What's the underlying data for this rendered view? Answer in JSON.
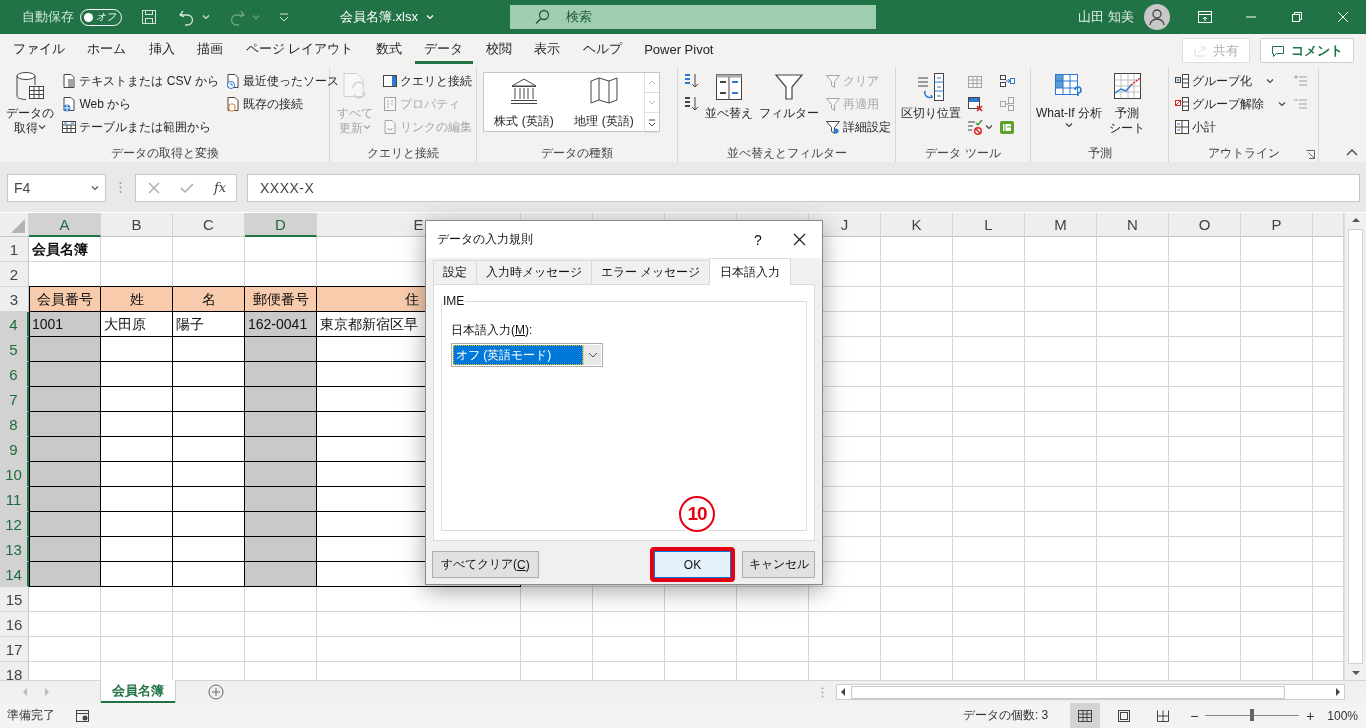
{
  "title_bar": {
    "autosave_label": "自動保存",
    "autosave_toggle": {
      "label": "オフ",
      "on": false
    },
    "file_name": "会員名簿.xlsx",
    "search": {
      "placeholder": "検索"
    },
    "user_name": "山田 知美"
  },
  "ribbon_tabs": [
    {
      "label": "ファイル",
      "selected": false
    },
    {
      "label": "ホーム",
      "selected": false
    },
    {
      "label": "挿入",
      "selected": false
    },
    {
      "label": "描画",
      "selected": false
    },
    {
      "label": "ページ レイアウト",
      "selected": false
    },
    {
      "label": "数式",
      "selected": false
    },
    {
      "label": "データ",
      "selected": true
    },
    {
      "label": "校閲",
      "selected": false
    },
    {
      "label": "表示",
      "selected": false
    },
    {
      "label": "ヘルプ",
      "selected": false
    },
    {
      "label": "Power Pivot",
      "selected": false
    }
  ],
  "share_button": {
    "label": "共有",
    "disabled": true
  },
  "comment_button": {
    "label": "コメント"
  },
  "ribbon_groups": [
    {
      "label": "データの取得と変換",
      "kind": "buttons",
      "columns": [
        [
          {
            "kind": "large",
            "label": "データの取得",
            "dropdown": true,
            "disabled": false
          }
        ],
        [
          {
            "kind": "small",
            "label": "テキストまたは CSV から",
            "dropdown": false,
            "disabled": false
          },
          {
            "kind": "small",
            "label": "Web から",
            "dropdown": false,
            "disabled": false
          },
          {
            "kind": "small",
            "label": "テーブルまたは範囲から",
            "dropdown": false,
            "disabled": false
          }
        ],
        [
          {
            "kind": "small",
            "label": "最近使ったソース",
            "dropdown": false,
            "disabled": false
          },
          {
            "kind": "small",
            "label": "既存の接続",
            "dropdown": false,
            "disabled": false
          }
        ]
      ]
    },
    {
      "label": "クエリと接続",
      "kind": "buttons",
      "columns": [
        [
          {
            "kind": "large",
            "label": "すべて更新",
            "dropdown": true,
            "disabled": true
          }
        ],
        [
          {
            "kind": "small",
            "label": "クエリと接続",
            "dropdown": false,
            "disabled": false
          },
          {
            "kind": "small",
            "label": "プロパティ",
            "dropdown": false,
            "disabled": true
          },
          {
            "kind": "small",
            "label": "リンクの編集",
            "dropdown": false,
            "disabled": true
          }
        ]
      ]
    },
    {
      "label": "データの種類",
      "kind": "gallery",
      "items": [
        {
          "label": "株式 (英語)"
        },
        {
          "label": "地理 (英語)"
        }
      ]
    },
    {
      "label": "並べ替えとフィルター",
      "kind": "buttons",
      "columns": [
        [
          {
            "kind": "icon",
            "dropdown": false,
            "disabled": false
          },
          {
            "kind": "icon",
            "dropdown": false,
            "disabled": false
          }
        ],
        [
          {
            "kind": "large",
            "label": "並べ替え",
            "dropdown": false,
            "disabled": false
          }
        ],
        [
          {
            "kind": "large",
            "label": "フィルター",
            "dropdown": false,
            "disabled": false
          }
        ],
        [
          {
            "kind": "small",
            "label": "クリア",
            "dropdown": false,
            "disabled": true
          },
          {
            "kind": "small",
            "label": "再適用",
            "dropdown": false,
            "disabled": true
          },
          {
            "kind": "small",
            "label": "詳細設定",
            "dropdown": false,
            "disabled": false
          }
        ]
      ]
    },
    {
      "label": "データ ツール",
      "kind": "buttons",
      "columns": [
        [
          {
            "kind": "large",
            "label": "区切り位置",
            "dropdown": false,
            "disabled": false
          }
        ],
        [
          {
            "kind": "icon",
            "dropdown": false,
            "disabled": true
          },
          {
            "kind": "icon",
            "dropdown": false,
            "disabled": false
          },
          {
            "kind": "icon",
            "dropdown": true,
            "disabled": false
          }
        ],
        [
          {
            "kind": "icon",
            "dropdown": false,
            "disabled": false
          },
          {
            "kind": "icon",
            "dropdown": false,
            "disabled": true
          },
          {
            "kind": "icon",
            "dropdown": false,
            "disabled": false
          }
        ]
      ]
    },
    {
      "label": "予測",
      "kind": "buttons",
      "columns": [
        [
          {
            "kind": "large",
            "label": "What-If 分析",
            "dropdown": true,
            "disabled": false
          }
        ],
        [
          {
            "kind": "large",
            "label": "予測シート",
            "dropdown": false,
            "disabled": false
          }
        ]
      ]
    },
    {
      "label": "アウトライン",
      "kind": "buttons",
      "launcher": true,
      "columns": [
        [
          {
            "kind": "small",
            "label": "グループ化",
            "dropdown": true,
            "disabled": false
          },
          {
            "kind": "small",
            "label": "グループ解除",
            "dropdown": true,
            "disabled": false
          },
          {
            "kind": "small",
            "label": "小計",
            "dropdown": false,
            "disabled": false
          }
        ],
        [
          {
            "kind": "icon",
            "dropdown": false,
            "disabled": true
          },
          {
            "kind": "icon",
            "dropdown": false,
            "disabled": true
          }
        ]
      ]
    }
  ],
  "formula_bar": {
    "name_box": "F4",
    "function_label": "fx",
    "value": "XXXX-X"
  },
  "grid": {
    "columns": [
      {
        "label": "A",
        "selected": true,
        "shaded": true,
        "in_table": true
      },
      {
        "label": "B",
        "selected": false,
        "shaded": false,
        "in_table": true
      },
      {
        "label": "C",
        "selected": false,
        "shaded": false,
        "in_table": true
      },
      {
        "label": "D",
        "selected": true,
        "shaded": true,
        "in_table": true
      },
      {
        "label": "E",
        "selected": false,
        "shaded": false,
        "in_table": true
      },
      {
        "selected": false,
        "shaded": false,
        "in_table": false
      },
      {
        "selected": false,
        "shaded": false,
        "in_table": false
      },
      {
        "selected": false,
        "shaded": false,
        "in_table": false
      },
      {
        "selected": false,
        "shaded": false,
        "in_table": false
      },
      {
        "label": "J",
        "selected": false,
        "shaded": false,
        "in_table": false
      },
      {
        "label": "K",
        "selected": false,
        "shaded": false,
        "in_table": false
      },
      {
        "label": "L",
        "selected": false,
        "shaded": false,
        "in_table": false
      },
      {
        "label": "M",
        "selected": false,
        "shaded": false,
        "in_table": false
      },
      {
        "label": "N",
        "selected": false,
        "shaded": false,
        "in_table": false
      },
      {
        "label": "O",
        "selected": false,
        "shaded": false,
        "in_table": false
      },
      {
        "label": "P",
        "selected": false,
        "shaded": false,
        "in_table": false
      }
    ],
    "rows": [
      {
        "label": "1",
        "selected": false,
        "kind": "title",
        "cells": [
          "会員名簿"
        ]
      },
      {
        "label": "2",
        "selected": false,
        "kind": "plain"
      },
      {
        "label": "3",
        "selected": false,
        "kind": "header",
        "cells": [
          "会員番号",
          "姓",
          "名",
          "郵便番号",
          "住"
        ]
      },
      {
        "label": "4",
        "selected": true,
        "kind": "data",
        "cells": [
          "1001",
          "大田原",
          "陽子",
          "162-0041",
          "東京都新宿区早"
        ]
      },
      {
        "label": "5",
        "selected": true,
        "kind": "data"
      },
      {
        "label": "6",
        "selected": true,
        "kind": "data"
      },
      {
        "label": "7",
        "selected": true,
        "kind": "data"
      },
      {
        "label": "8",
        "selected": true,
        "kind": "data"
      },
      {
        "label": "9",
        "selected": true,
        "kind": "data"
      },
      {
        "label": "10",
        "selected": true,
        "kind": "data"
      },
      {
        "label": "11",
        "selected": true,
        "kind": "data"
      },
      {
        "label": "12",
        "selected": true,
        "kind": "data"
      },
      {
        "label": "13",
        "selected": true,
        "kind": "data"
      },
      {
        "label": "14",
        "selected": true,
        "kind": "data"
      },
      {
        "label": "15",
        "selected": false,
        "kind": "plain"
      },
      {
        "label": "16",
        "selected": false,
        "kind": "plain"
      },
      {
        "label": "17",
        "selected": false,
        "kind": "plain"
      },
      {
        "label": "18",
        "selected": false,
        "kind": "plain"
      }
    ]
  },
  "dialog": {
    "title": "データの入力規則",
    "help": "?",
    "tabs": [
      {
        "label": "設定",
        "selected": false
      },
      {
        "label": "入力時メッセージ",
        "selected": false
      },
      {
        "label": "エラー メッセージ",
        "selected": false
      },
      {
        "label": "日本語入力",
        "selected": true
      }
    ],
    "group_label": "IME",
    "field_label": {
      "text": "日本語入力(",
      "access_key": "M",
      "text_after": "):"
    },
    "select": {
      "value": "オフ (英語モード)",
      "focused": true
    },
    "buttons": [
      {
        "text": "すべてクリア(",
        "access_key": "C",
        "text_after": ")",
        "default": false,
        "highlighted": false
      },
      {
        "text": "OK",
        "default": true,
        "highlighted": true
      },
      {
        "text": "キャンセル",
        "default": false,
        "highlighted": false
      }
    ],
    "step_marker": "10"
  },
  "sheet_tabs": [
    {
      "label": "会員名簿",
      "selected": true
    }
  ],
  "status_bar": {
    "status": "準備完了",
    "count_label": "データの個数: 3",
    "views": [
      {
        "selected": true
      },
      {
        "selected": false
      },
      {
        "selected": false
      }
    ],
    "zoom": {
      "out": "−",
      "in": "+",
      "level": 0.5,
      "reading": "100%"
    }
  }
}
